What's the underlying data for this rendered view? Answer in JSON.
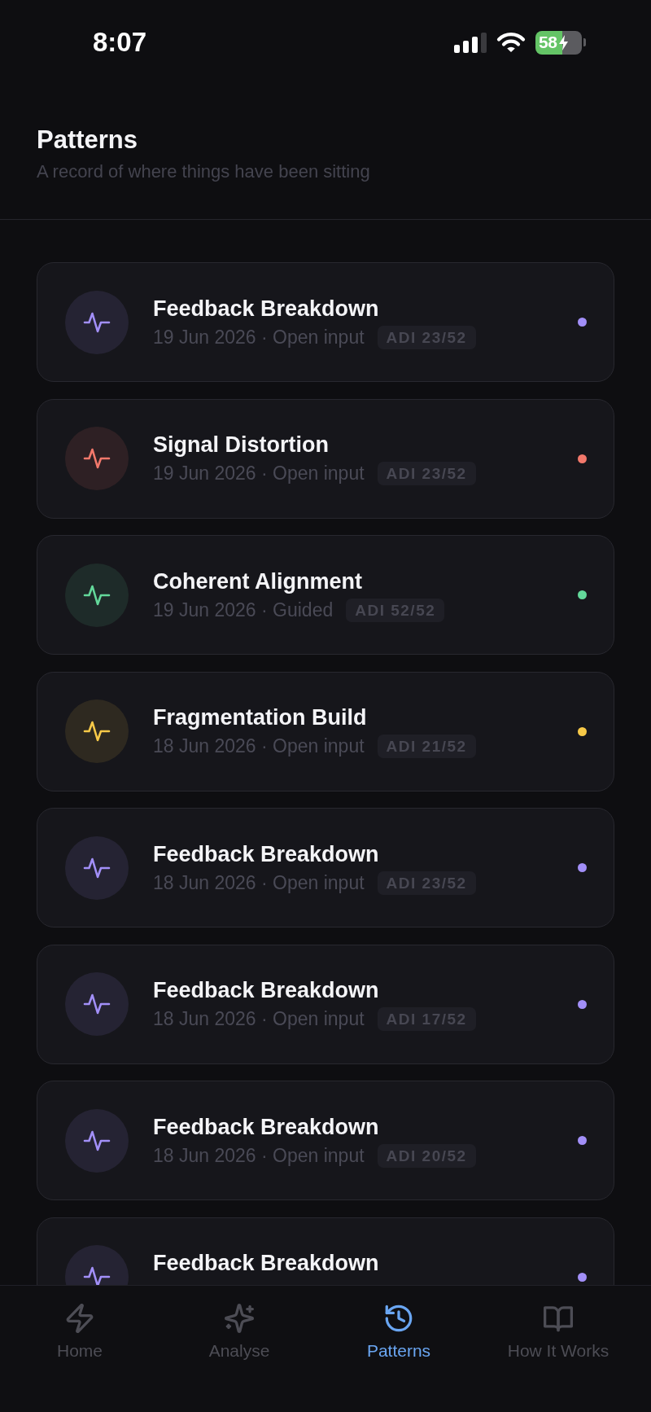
{
  "status_bar": {
    "time": "8:07",
    "battery": "58",
    "charging": true
  },
  "header": {
    "title": "Patterns",
    "subtitle": "A record of where things have been sitting"
  },
  "patterns": [
    {
      "title": "Feedback Breakdown",
      "meta": "19 Jun 2026 · Open input",
      "badge": "ADI 23/52",
      "color": "#a28ff8"
    },
    {
      "title": "Signal Distortion",
      "meta": "19 Jun 2026 · Open input",
      "badge": "ADI 23/52",
      "color": "#f2786b"
    },
    {
      "title": "Coherent Alignment",
      "meta": "19 Jun 2026 · Guided",
      "badge": "ADI 52/52",
      "color": "#63d89a"
    },
    {
      "title": "Fragmentation Build",
      "meta": "18 Jun 2026 · Open input",
      "badge": "ADI 21/52",
      "color": "#f7c948"
    },
    {
      "title": "Feedback Breakdown",
      "meta": "18 Jun 2026 · Open input",
      "badge": "ADI 23/52",
      "color": "#a28ff8"
    },
    {
      "title": "Feedback Breakdown",
      "meta": "18 Jun 2026 · Open input",
      "badge": "ADI 17/52",
      "color": "#a28ff8"
    },
    {
      "title": "Feedback Breakdown",
      "meta": "18 Jun 2026 · Open input",
      "badge": "ADI 20/52",
      "color": "#a28ff8"
    },
    {
      "title": "Feedback Breakdown",
      "color": "#a28ff8"
    }
  ],
  "tab_bar": [
    {
      "label": "Home",
      "selected": false
    },
    {
      "label": "Analyse",
      "selected": false
    },
    {
      "label": "Patterns",
      "selected": true
    },
    {
      "label": "How It Works",
      "selected": false
    }
  ]
}
